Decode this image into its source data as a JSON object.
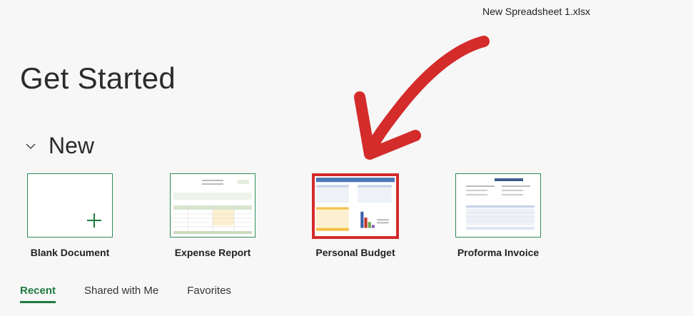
{
  "window": {
    "filename": "New Spreadsheet 1.xlsx"
  },
  "page": {
    "title": "Get Started"
  },
  "new_section": {
    "label": "New"
  },
  "templates": [
    {
      "label": "Blank Document"
    },
    {
      "label": "Expense Report"
    },
    {
      "label": "Personal Budget",
      "selected": true
    },
    {
      "label": "Proforma Invoice"
    }
  ],
  "tabs": [
    {
      "label": "Recent",
      "active": true
    },
    {
      "label": "Shared with Me"
    },
    {
      "label": "Favorites"
    }
  ],
  "colors": {
    "accent": "#1f7a3f",
    "highlight": "#d42b2b",
    "border": "#2e8b57"
  }
}
